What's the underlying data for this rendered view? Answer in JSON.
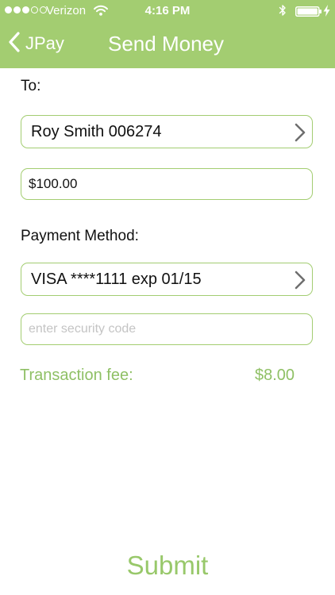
{
  "status_bar": {
    "carrier": "Verizon",
    "time": "4:16 PM",
    "signal_bars_filled": 3,
    "signal_bars_total": 5,
    "battery_level": 1.0
  },
  "nav": {
    "back_label": "JPay",
    "title": "Send Money"
  },
  "form": {
    "to_label": "To:",
    "recipient": "Roy Smith 006274",
    "amount": "$100.00",
    "payment_method_label": "Payment Method:",
    "payment_method": "VISA ****1111 exp 01/15",
    "security_code_placeholder": "enter security code",
    "fee_label": "Transaction fee:",
    "fee_value": "$8.00",
    "submit_label": "Submit"
  },
  "icons": {
    "back": "chevron-left-icon",
    "disclosure": "chevron-right-icon",
    "wifi": "wifi-icon",
    "bluetooth": "bluetooth-icon",
    "battery": "battery-icon",
    "charging": "lightning-icon"
  },
  "colors": {
    "brand_green": "#a3cd71",
    "accent_text_green": "#8fc065",
    "placeholder_gray": "#c4c4c4"
  }
}
